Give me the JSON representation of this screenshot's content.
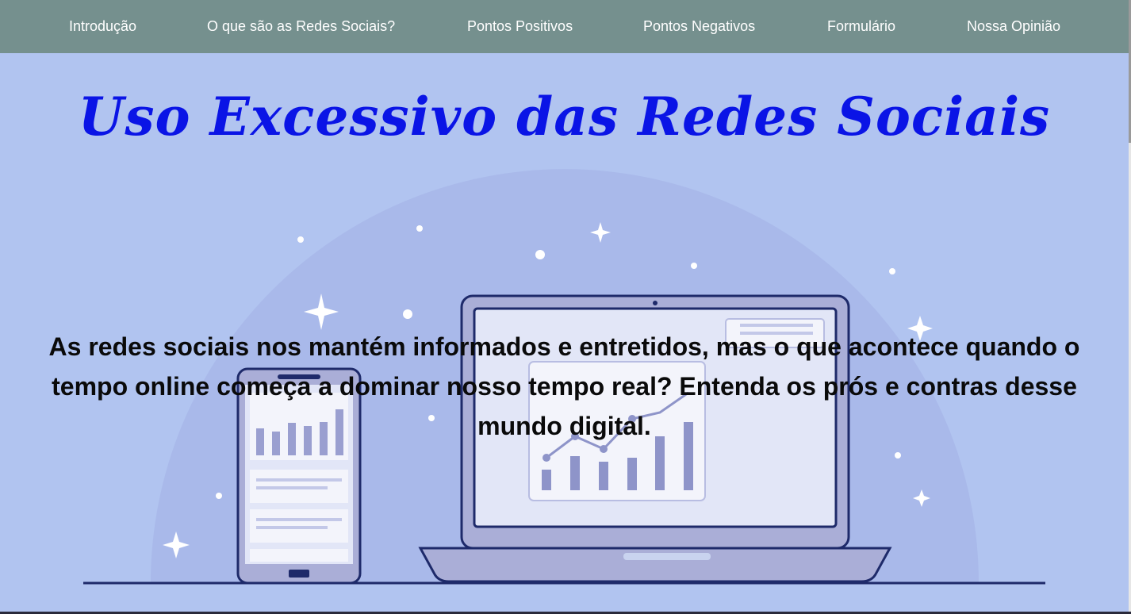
{
  "nav": {
    "items": [
      {
        "label": "Introdução"
      },
      {
        "label": "O que são as Redes Sociais?"
      },
      {
        "label": "Pontos Positivos"
      },
      {
        "label": "Pontos Negativos"
      },
      {
        "label": "Formulário"
      },
      {
        "label": "Nossa Opinião"
      }
    ]
  },
  "hero": {
    "title": "Uso Excessivo das Redes Sociais",
    "text": "As redes sociais nos mantém informados e entretidos, mas o que acontece quando o tempo online começa a dominar nosso tempo real? Entenda os prós e contras desse mundo digital."
  },
  "colors": {
    "navbar": "#75908e",
    "background": "#b1c4f0",
    "title": "#0a14e6",
    "illustration_outline": "#1e2a6a"
  },
  "illustration": {
    "icons": [
      "laptop-icon",
      "smartphone-icon",
      "bar-chart-icon",
      "line-chart-icon",
      "sparkle-icon"
    ]
  }
}
